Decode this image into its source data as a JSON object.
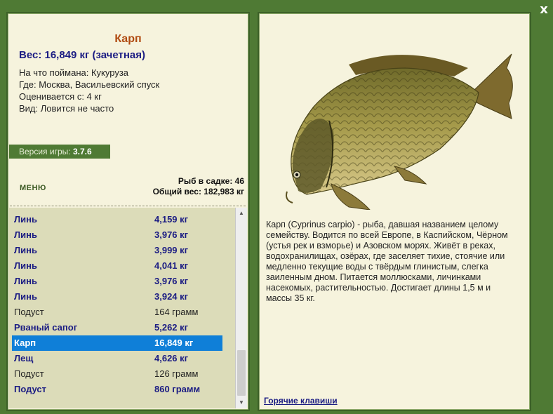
{
  "close": {
    "label": "x"
  },
  "fish": {
    "title": "Карп",
    "weight": "Вес: 16,849 кг (зачетная)",
    "info": [
      "На что поймана: Кукуруза",
      "Где: Москва, Васильевский спуск",
      "Оценивается с: 4 кг",
      "Вид: Ловится не часто"
    ],
    "description": "Карп (Cyprinus carpio) - рыба, давшая названием целому семейству. Водится по всей Европе, в Каспийском, Чёрном (устья рек и взморье) и Азовском морях. Живёт в реках, водохранилищах, озёрах, где заселяет тихие, стоячие или медленно текущие воды с твёрдым глинистым, слегка заиленным дном. Питается моллюсками, личинками насекомых, растительностью. Достигает длины 1,5 м и массы 35 кг."
  },
  "version": {
    "label": "Версия игры:",
    "value": "3.7.6"
  },
  "menu": {
    "label": "МЕНЮ"
  },
  "stats": {
    "count_line": "Рыб в садке: 46",
    "weight_line": "Общий вес: 182,983 кг"
  },
  "catch_list": [
    {
      "name": "Линь",
      "weight": "4,159 кг",
      "style": "b"
    },
    {
      "name": "Линь",
      "weight": "3,976 кг",
      "style": "b"
    },
    {
      "name": "Линь",
      "weight": "3,999 кг",
      "style": "b"
    },
    {
      "name": "Линь",
      "weight": "4,041 кг",
      "style": "b"
    },
    {
      "name": "Линь",
      "weight": "3,976 кг",
      "style": "b"
    },
    {
      "name": "Линь",
      "weight": "3,924 кг",
      "style": "b"
    },
    {
      "name": "Подуст",
      "weight": "164 грамм",
      "style": "n"
    },
    {
      "name": "Рваный сапог",
      "weight": "5,262 кг",
      "style": "b"
    },
    {
      "name": "Карп",
      "weight": "16,849 кг",
      "style": "sel"
    },
    {
      "name": "Лещ",
      "weight": "4,626 кг",
      "style": "b"
    },
    {
      "name": "Подуст",
      "weight": "126 грамм",
      "style": "n"
    },
    {
      "name": "Подуст",
      "weight": "860 грамм",
      "style": "b"
    }
  ],
  "hotkeys": {
    "label": "Горячие клавиши"
  },
  "icons": {
    "close": "close-icon",
    "scroll_up": "scroll-up-icon",
    "scroll_down": "scroll-down-icon"
  },
  "colors": {
    "background": "#4f7a34",
    "panel": "#f6f3dd",
    "selection": "#0f7fd8",
    "bold_text": "#1b1c83",
    "title": "#b04a10"
  }
}
